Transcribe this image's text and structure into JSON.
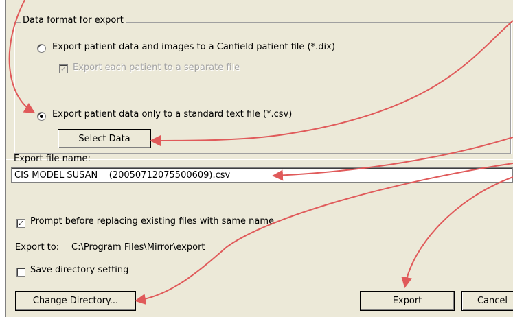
{
  "data_format": {
    "group_label": "Data format for export",
    "option_dix_label": "Export patient data and images to a Canfield patient file (*.dix)",
    "option_dix_selected": false,
    "separate_file_label": "Export each patient to a separate file",
    "separate_file_checked": true,
    "separate_file_enabled": false,
    "option_csv_label": "Export patient data only to a standard text file (*.csv)",
    "option_csv_selected": true,
    "select_data_label": "Select Data"
  },
  "file": {
    "name_label": "Export file name:",
    "name_value": "CIS MODEL SUSAN    (20050712075500609).csv"
  },
  "prompt_replace": {
    "label": "Prompt before replacing existing files with same name",
    "checked": true
  },
  "export_to": {
    "label": "Export to:",
    "path": "C:\\Program Files\\Mirror\\export"
  },
  "save_directory": {
    "label": "Save directory setting",
    "checked": false
  },
  "buttons": {
    "change_directory": "Change Directory...",
    "export": "Export",
    "cancel": "Cancel"
  },
  "annotation_color": "#e05a5a",
  "icons": {
    "check": "✓"
  }
}
